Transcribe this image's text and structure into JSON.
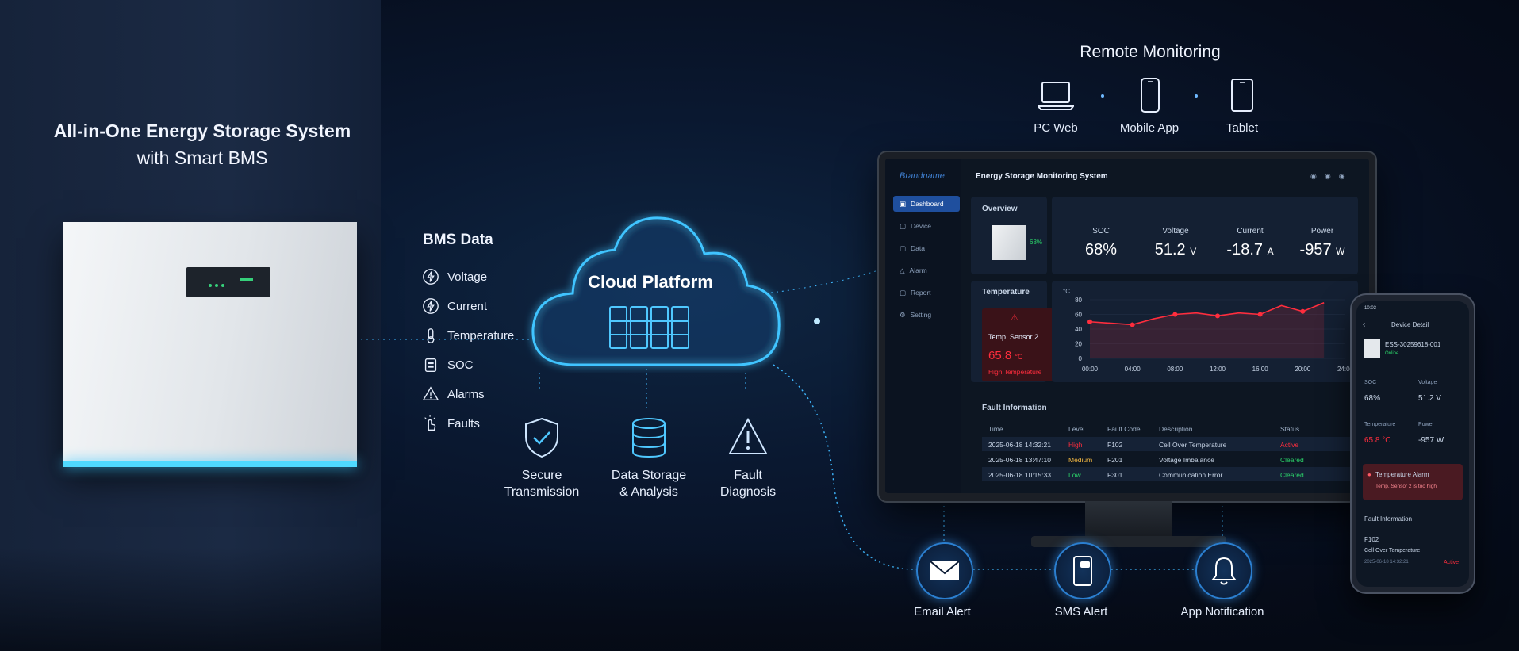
{
  "ess": {
    "title_line1": "All-in-One Energy Storage System",
    "title_line2": "with Smart BMS"
  },
  "bms": {
    "title": "BMS Data",
    "items": [
      {
        "label": "Voltage",
        "icon": "lightning-icon"
      },
      {
        "label": "Current",
        "icon": "lightning-icon"
      },
      {
        "label": "Temperature",
        "icon": "thermometer-icon"
      },
      {
        "label": "SOC",
        "icon": "battery-icon"
      },
      {
        "label": "Alarms",
        "icon": "warning-icon"
      },
      {
        "label": "Faults",
        "icon": "fault-icon"
      }
    ]
  },
  "cloud": {
    "title": "Cloud Platform",
    "services": [
      {
        "line1": "Secure",
        "line2": "Transmission",
        "icon": "shield-check-icon"
      },
      {
        "line1": "Data Storage",
        "line2": "& Analysis",
        "icon": "database-icon"
      },
      {
        "line1": "Fault",
        "line2": "Diagnosis",
        "icon": "warning-icon"
      }
    ]
  },
  "remote": {
    "title": "Remote Monitoring",
    "devices": [
      {
        "label": "PC Web",
        "icon": "laptop-icon"
      },
      {
        "label": "Mobile App",
        "icon": "phone-icon"
      },
      {
        "label": "Tablet",
        "icon": "tablet-icon"
      }
    ]
  },
  "alerts": [
    {
      "label": "Email Alert",
      "icon": "envelope-icon"
    },
    {
      "label": "SMS Alert",
      "icon": "sms-icon"
    },
    {
      "label": "App Notification",
      "icon": "bell-icon"
    }
  ],
  "dashboard": {
    "brand": "Brandname",
    "title": "Energy Storage Monitoring System",
    "nav": [
      "Dashboard",
      "Device",
      "Data",
      "Alarm",
      "Report",
      "Setting"
    ],
    "overview": {
      "title": "Overview",
      "soc_badge": "68%",
      "metrics": [
        {
          "label": "SOC",
          "value": "68%",
          "unit": ""
        },
        {
          "label": "Voltage",
          "value": "51.2",
          "unit": "V"
        },
        {
          "label": "Current",
          "value": "-18.7",
          "unit": "A"
        },
        {
          "label": "Power",
          "value": "-957",
          "unit": "W"
        }
      ]
    },
    "temperature": {
      "title": "Temperature",
      "sensor": "Temp. Sensor 2",
      "value": "65.8",
      "unit": "°C",
      "status": "High Temperature"
    },
    "faults": {
      "title": "Fault Information",
      "headers": [
        "Time",
        "Level",
        "Fault Code",
        "Description",
        "Status"
      ],
      "rows": [
        {
          "time": "2025-06-18 14:32:21",
          "level": "High",
          "code": "F102",
          "desc": "Cell Over Temperature",
          "status": "Active"
        },
        {
          "time": "2025-06-18 13:47:10",
          "level": "Medium",
          "code": "F201",
          "desc": "Voltage Imbalance",
          "status": "Cleared"
        },
        {
          "time": "2025-06-18 10:15:33",
          "level": "Low",
          "code": "F301",
          "desc": "Communication Error",
          "status": "Cleared"
        }
      ]
    }
  },
  "chart_data": {
    "type": "line",
    "title": "",
    "ylabel": "°C",
    "xlabel": "",
    "x": [
      "00:00",
      "04:00",
      "08:00",
      "12:00",
      "16:00",
      "20:00",
      "24:00"
    ],
    "y_ticks": [
      0,
      20,
      40,
      60,
      80
    ],
    "ylim": [
      0,
      80
    ],
    "grid": true,
    "series": [
      {
        "values": [
          50,
          48,
          46,
          54,
          60,
          62,
          58,
          62,
          60,
          72,
          64,
          76
        ],
        "point_times": [
          "00:00",
          "02:00",
          "04:00",
          "06:00",
          "08:00",
          "10:00",
          "12:00",
          "14:00",
          "16:00",
          "18:00",
          "20:00",
          "22:00"
        ],
        "color": "#ff2d3d"
      }
    ]
  },
  "phone": {
    "time": "10:03",
    "title": "Device Detail",
    "device_id": "ESS-30259618-001",
    "online": "Online",
    "soc_label": "SOC",
    "soc_value": "68%",
    "voltage_label": "Voltage",
    "voltage_value": "51.2 V",
    "temp_label": "Temperature",
    "temp_value": "65.8 °C",
    "power_label": "Power",
    "power_value": "-957 W",
    "alarm_title": "Temperature Alarm",
    "alarm_text": "Temp. Sensor 2 is too high",
    "fault_title": "Fault Information",
    "fault_code": "F102",
    "fault_desc": "Cell Over Temperature",
    "fault_time": "2025-06-18 14:32:21",
    "fault_status": "Active"
  },
  "colors": {
    "accent": "#3fb8ff",
    "alarm": "#ff2d3d",
    "ok": "#2bd46a",
    "warn": "#f5b942"
  }
}
